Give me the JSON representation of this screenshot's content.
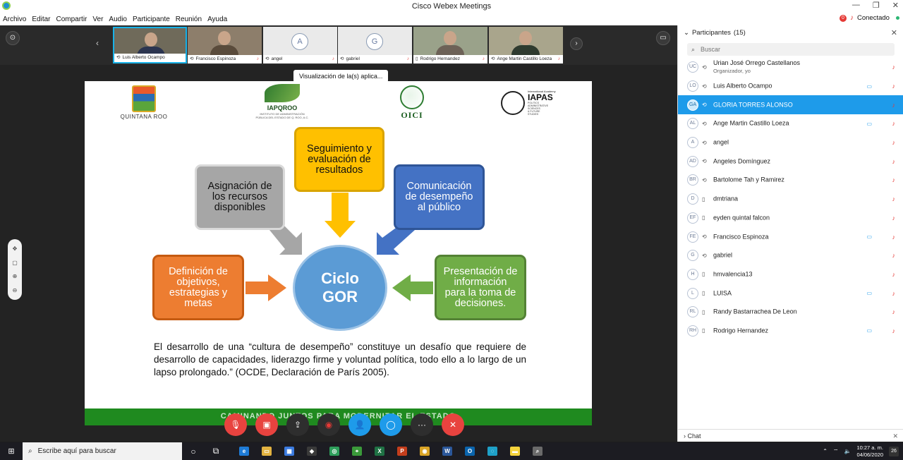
{
  "window": {
    "title": "Cisco Webex Meetings",
    "minimize": "—",
    "restore": "❐",
    "close": "✕"
  },
  "menu": [
    "Archivo",
    "Editar",
    "Compartir",
    "Ver",
    "Audio",
    "Participante",
    "Reunión",
    "Ayuda"
  ],
  "status": {
    "badge": "0",
    "text": "Conectado"
  },
  "thumbnails": [
    {
      "name": "Luis Alberto Ocampo",
      "type": "video",
      "active": true
    },
    {
      "name": "Francisco Espinoza",
      "type": "video",
      "active": false
    },
    {
      "name": "angel",
      "initial": "A",
      "type": "avatar",
      "active": false
    },
    {
      "name": "gabriel",
      "initial": "G",
      "type": "avatar",
      "active": false
    },
    {
      "name": "Rodrigo Hernandez",
      "type": "video",
      "active": false
    },
    {
      "name": "Ange Martin Castillo Loeza",
      "type": "video",
      "active": false
    }
  ],
  "share_tooltip": "Visualización de la(s) aplica...",
  "slide": {
    "logos": {
      "qroo": "QUINTANA ROO",
      "iapqroo": "IAPQROO",
      "iapqroo_sub": "INSTITUTO DE ADMINISTRACIÓN PÚBLICA DEL ESTADO DE Q. ROO, A.C.",
      "oici": "OICI",
      "iapas_top": "International Academy",
      "iapas": "IAPAS",
      "iapas_sub1": "POLITICS",
      "iapas_sub2": "ADMINISTRATIVE",
      "iapas_sub3": "SCIENCES",
      "iapas_sub4": "& FUTURE",
      "iapas_sub5": "STUDIES"
    },
    "boxes": {
      "yellow": [
        "Seguimiento y",
        "evaluación de",
        "resultados"
      ],
      "gray": [
        "Asignación de",
        "los recursos",
        "disponibles"
      ],
      "blue": [
        "Comunicación",
        "de desempeño",
        "al público"
      ],
      "orange": [
        "Definición de",
        "objetivos,",
        "estrategias y",
        "metas"
      ],
      "green": [
        "Presentación de",
        "información",
        "para la toma de",
        "decisiones."
      ]
    },
    "center": [
      "Ciclo",
      "GOR"
    ],
    "quote": "El desarrollo de una “cultura de desempeño” constituye un desafío que requiere de desarrollo de capacidades, liderazgo firme y voluntad política, todo ello a lo largo de un lapso prolongado.” (OCDE, Declaración de París 2005).",
    "footer": "CAMINANDO JUNTOS PARA MODERNIZAR EL ESTADO"
  },
  "participants_panel": {
    "title": "Participantes",
    "count": "(15)",
    "search_placeholder": "Buscar",
    "chat_label": "Chat",
    "list": [
      {
        "initials": "UC",
        "name": "Urian José  Orrego Castellanos",
        "role": "Organizador, yo",
        "device": "⟲",
        "cam": false,
        "selected": false
      },
      {
        "initials": "LO",
        "name": "Luis Alberto Ocampo",
        "role": "",
        "device": "⟲",
        "cam": true,
        "selected": false
      },
      {
        "initials": "GA",
        "name": "GLORIA TORRES ALONSO",
        "role": "",
        "device": "⟲",
        "cam": false,
        "selected": true
      },
      {
        "initials": "AL",
        "name": "Ange Martin Castillo Loeza",
        "role": "",
        "device": "⟲",
        "cam": true,
        "selected": false
      },
      {
        "initials": "A",
        "name": "angel",
        "role": "",
        "device": "⟲",
        "cam": false,
        "selected": false
      },
      {
        "initials": "AD",
        "name": "Angeles Domínguez",
        "role": "",
        "device": "⟲",
        "cam": false,
        "selected": false
      },
      {
        "initials": "BR",
        "name": "Bartolome Tah y Ramirez",
        "role": "",
        "device": "⟲",
        "cam": false,
        "selected": false
      },
      {
        "initials": "D",
        "name": "dmtriana",
        "role": "",
        "device": "▯",
        "cam": false,
        "selected": false
      },
      {
        "initials": "EF",
        "name": "eyden quintal falcon",
        "role": "",
        "device": "▯",
        "cam": false,
        "selected": false
      },
      {
        "initials": "FE",
        "name": "Francisco Espinoza",
        "role": "",
        "device": "⟲",
        "cam": true,
        "selected": false
      },
      {
        "initials": "G",
        "name": "gabriel",
        "role": "",
        "device": "⟲",
        "cam": false,
        "selected": false
      },
      {
        "initials": "H",
        "name": "hmvalencia13",
        "role": "",
        "device": "▯",
        "cam": false,
        "selected": false
      },
      {
        "initials": "L",
        "name": "LUISA",
        "role": "",
        "device": "▯",
        "cam": true,
        "selected": false
      },
      {
        "initials": "RL",
        "name": "Randy Bastarrachea De Leon",
        "role": "",
        "device": "▯",
        "cam": false,
        "selected": false
      },
      {
        "initials": "RH",
        "name": "Rodrigo Hernandez",
        "role": "",
        "device": "▯",
        "cam": true,
        "selected": false
      }
    ]
  },
  "taskbar": {
    "search_placeholder": "Escribe aquí para buscar",
    "time": "10:27 a. m.",
    "date": "04/06/2020",
    "notifications": "26",
    "apps": [
      {
        "name": "edge",
        "label": "e",
        "color": "#1e7bd6"
      },
      {
        "name": "explorer",
        "label": "▭",
        "color": "#e3b341"
      },
      {
        "name": "store",
        "label": "▦",
        "color": "#3b7be0"
      },
      {
        "name": "dropbox",
        "label": "◆",
        "color": "#3a3a3a"
      },
      {
        "name": "tripadvisor",
        "label": "◎",
        "color": "#2e9f5b"
      },
      {
        "name": "maps",
        "label": "⌖",
        "color": "#3a9a3a"
      },
      {
        "name": "excel",
        "label": "X",
        "color": "#1f7244"
      },
      {
        "name": "powerpoint",
        "label": "P",
        "color": "#c43e1c"
      },
      {
        "name": "chrome",
        "label": "◉",
        "color": "#d9a426"
      },
      {
        "name": "word",
        "label": "W",
        "color": "#2b579a"
      },
      {
        "name": "outlook",
        "label": "O",
        "color": "#0a64ad"
      },
      {
        "name": "webex",
        "label": "◌",
        "color": "#1ea0c8"
      },
      {
        "name": "sticky-notes",
        "label": "▬",
        "color": "#f5d33d"
      },
      {
        "name": "remote",
        "label": "⌕",
        "color": "#6a6a6a"
      }
    ]
  },
  "controls": [
    "mute",
    "stop-video",
    "share",
    "record",
    "participants",
    "chat",
    "more",
    "end"
  ]
}
